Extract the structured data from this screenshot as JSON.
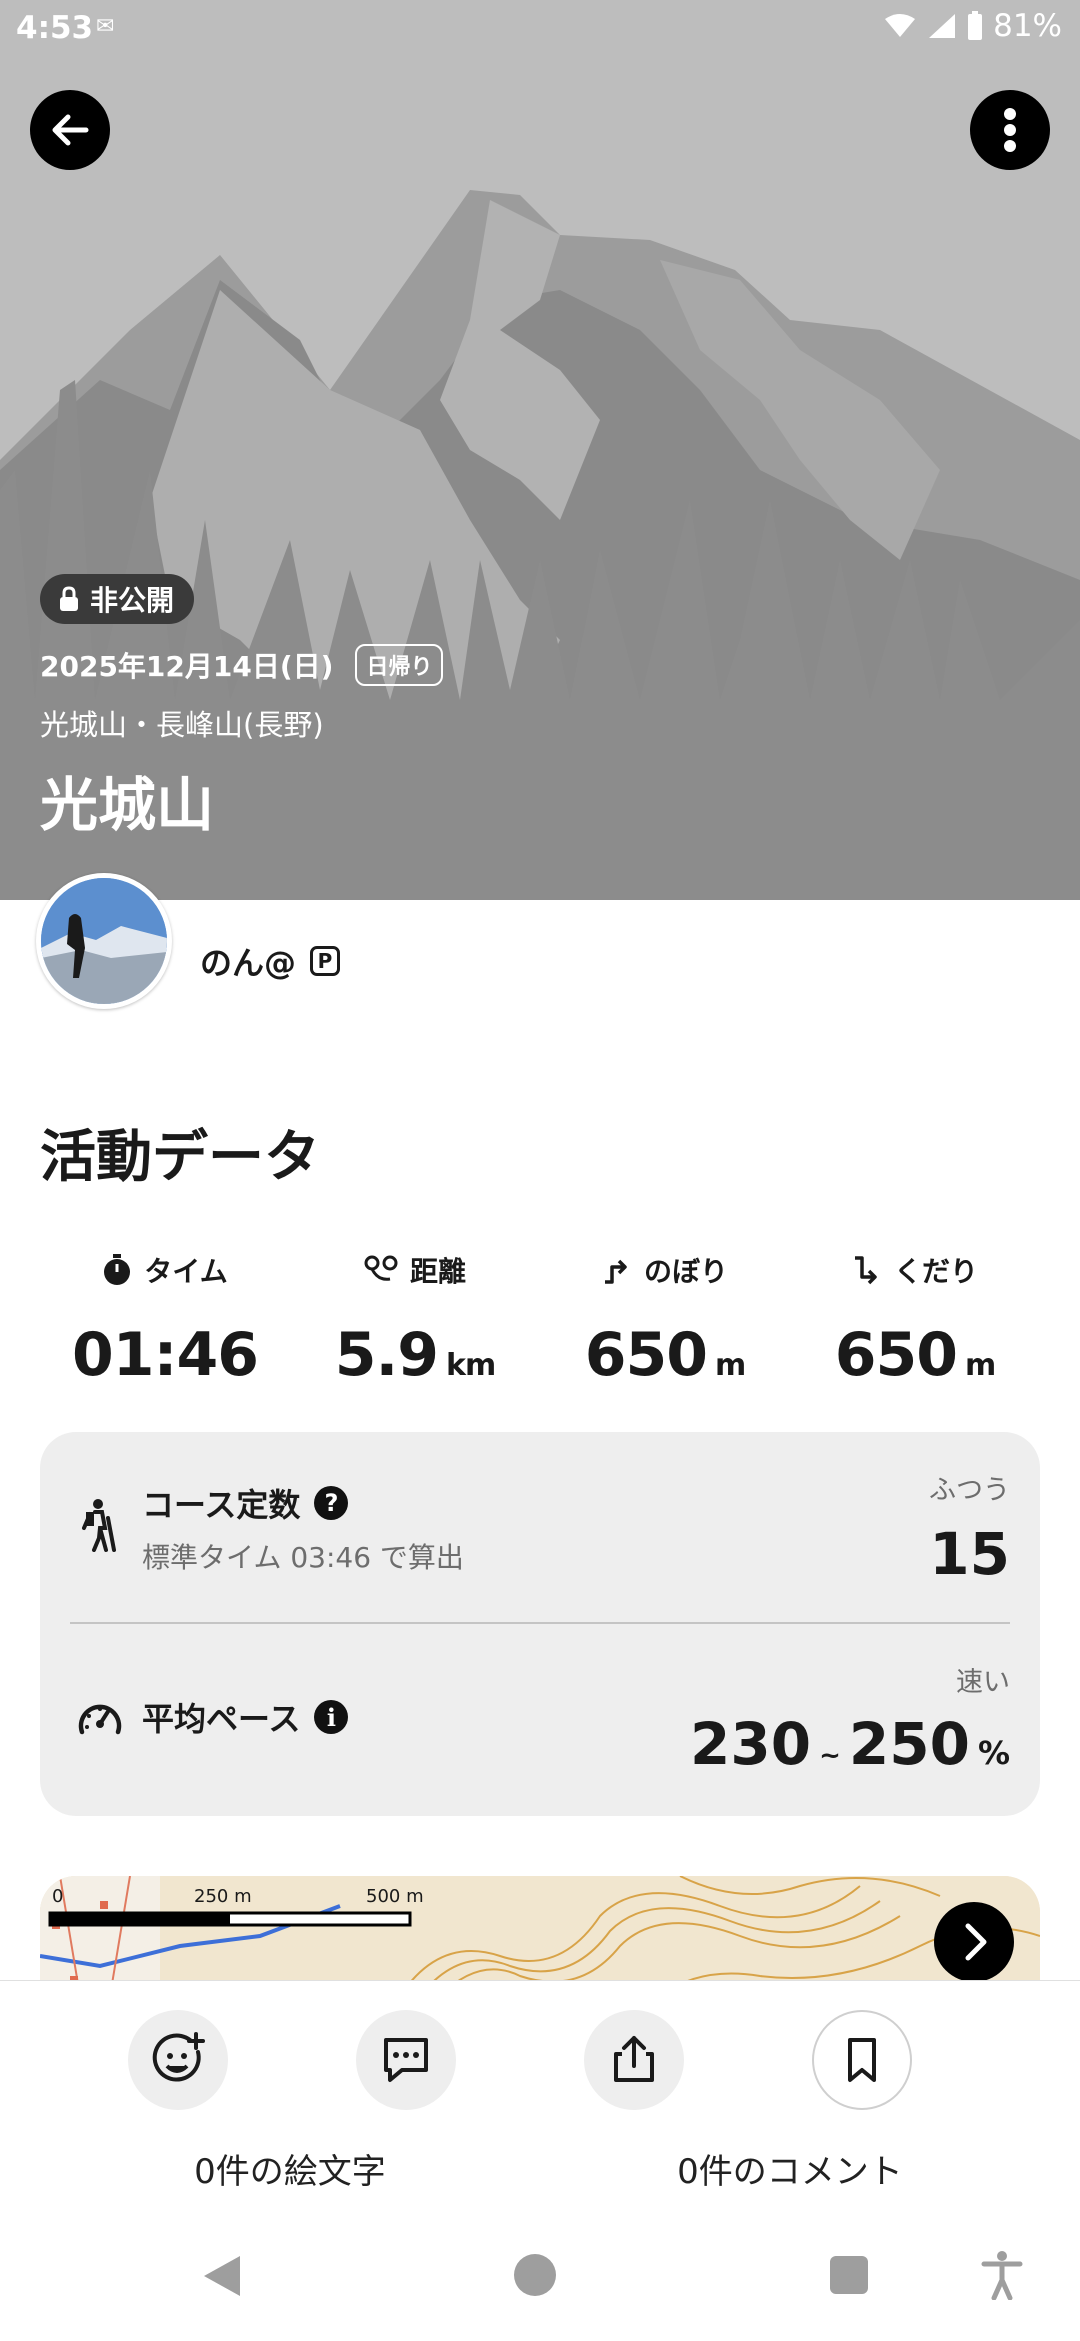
{
  "status_bar": {
    "time": "4:53",
    "battery": "81%"
  },
  "hero": {
    "privacy_label": "非公開",
    "date": "2025年12月14日(日)",
    "trip_type": "日帰り",
    "area": "光城山・長峰山(長野)",
    "title": "光城山"
  },
  "user": {
    "name": "のん@",
    "badge": "P"
  },
  "activity": {
    "section_title": "活動データ",
    "stats": [
      {
        "label": "タイム",
        "value": "01:46",
        "unit": ""
      },
      {
        "label": "距離",
        "value": "5.9",
        "unit": "km"
      },
      {
        "label": "のぼり",
        "value": "650",
        "unit": "m"
      },
      {
        "label": "くだり",
        "value": "650",
        "unit": "m"
      }
    ]
  },
  "course": {
    "title": "コース定数",
    "subtitle": "標準タイム 03:46 で算出",
    "level": "ふつう",
    "value": "15"
  },
  "pace": {
    "title": "平均ペース",
    "level": "速い",
    "min": "230",
    "sep": "~",
    "max": "250",
    "unit": "%"
  },
  "map": {
    "scale_0": "0",
    "scale_250": "250 m",
    "scale_500": "500 m"
  },
  "actions": {
    "emoji_count": "0件の絵文字",
    "comment_count": "0件のコメント"
  },
  "colors": {
    "hero_bg": "#bdbdbd",
    "card_bg": "#eeeeee",
    "text": "#1a1a1a"
  }
}
